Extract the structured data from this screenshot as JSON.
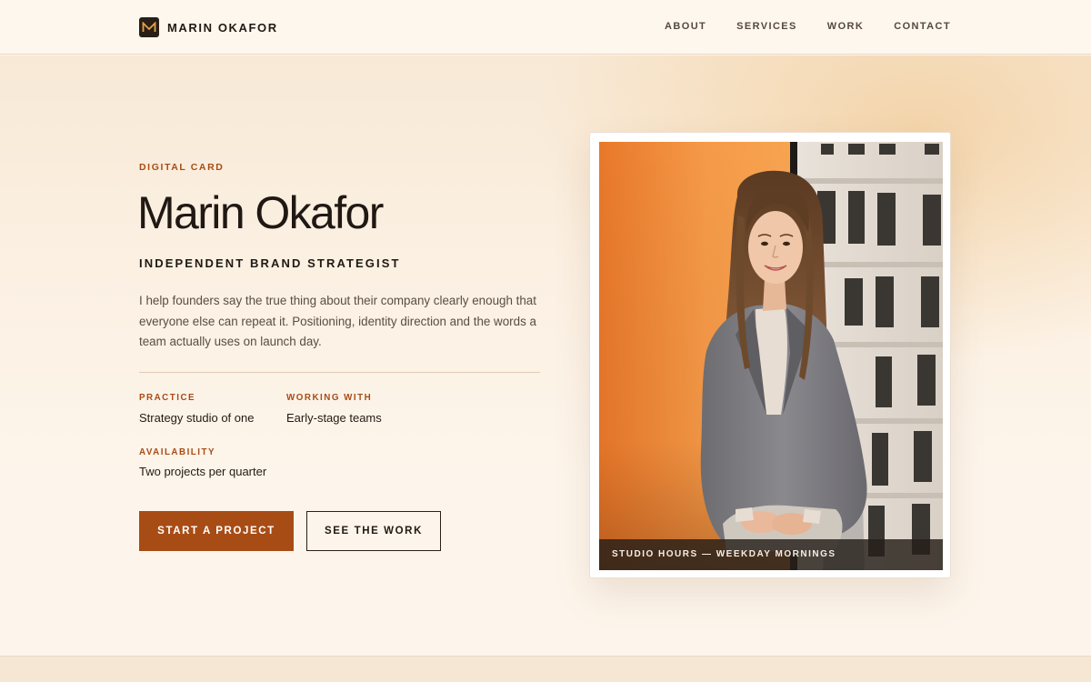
{
  "header": {
    "brand_name": "MARIN OKAFOR",
    "brand_icon": "m-monogram-icon",
    "nav": [
      {
        "label": "ABOUT"
      },
      {
        "label": "SERVICES"
      },
      {
        "label": "WORK"
      },
      {
        "label": "CONTACT"
      }
    ]
  },
  "hero": {
    "eyebrow": "DIGITAL CARD",
    "name": "Marin Okafor",
    "role": "INDEPENDENT BRAND STRATEGIST",
    "bio": "I help founders say the true thing about their company clearly enough that everyone else can repeat it. Positioning, identity direction and the words a team actually uses on launch day.",
    "facts": [
      {
        "label": "PRACTICE",
        "value": "Strategy studio of one"
      },
      {
        "label": "WORKING WITH",
        "value": "Early-stage teams"
      },
      {
        "label": "AVAILABILITY",
        "value": "Two projects per quarter"
      }
    ],
    "primary_button": "START A PROJECT",
    "secondary_button": "SEE THE WORK"
  },
  "photo_card": {
    "caption": "STUDIO HOURS — WEEKDAY MORNINGS"
  },
  "colors": {
    "accent": "#a84c16",
    "background": "#fdf5ea",
    "text": "#231a14"
  }
}
